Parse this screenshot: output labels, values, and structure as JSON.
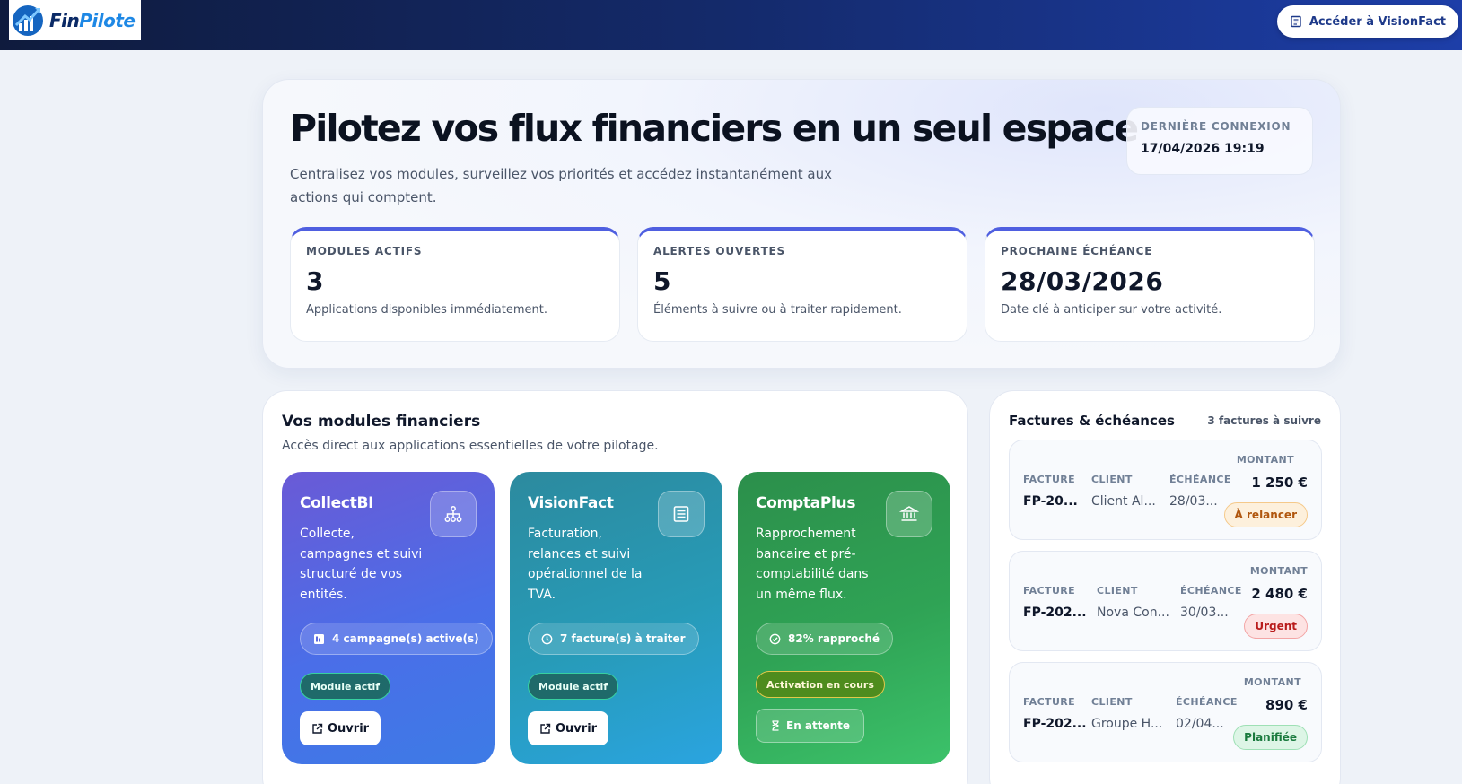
{
  "header": {
    "logo_fin": "Fin",
    "logo_pilote": "Pilote",
    "action_label": "Accéder à VisionFact"
  },
  "hero": {
    "title": "Pilotez vos flux financiers en un seul espace",
    "subtitle": "Centralisez vos modules, surveillez vos priorités et accédez instantanément aux actions qui comptent.",
    "last_login": {
      "label": "DERNIÈRE CONNEXION",
      "value": "17/04/2026 19:19"
    },
    "stats": [
      {
        "label": "MODULES ACTIFS",
        "value": "3",
        "description": "Applications disponibles immédiatement."
      },
      {
        "label": "ALERTES OUVERTES",
        "value": "5",
        "description": "Éléments à suivre ou à traiter rapidement."
      },
      {
        "label": "PROCHAINE ÉCHÉANCE",
        "value": "28/03/2026",
        "description": "Date clé à anticiper sur votre activité."
      }
    ]
  },
  "modules": {
    "title": "Vos modules financiers",
    "subtitle": "Accès direct aux applications essentielles de votre pilotage.",
    "items": [
      {
        "name": "CollectBI",
        "description": "Collecte, campagnes et suivi structuré de vos entités.",
        "stat": "4 campagne(s) active(s)",
        "status": "Module actif",
        "action": "Ouvrir",
        "icon": "sitemap-icon"
      },
      {
        "name": "VisionFact",
        "description": "Facturation, relances et suivi opérationnel de la TVA.",
        "stat": "7 facture(s) à traiter",
        "status": "Module actif",
        "action": "Ouvrir",
        "icon": "invoice-icon"
      },
      {
        "name": "ComptaPlus",
        "description": "Rapprochement bancaire et pré-comptabilité dans un même flux.",
        "stat": "82% rapproché",
        "status": "Activation en cours",
        "action": "En attente",
        "icon": "bank-icon"
      }
    ]
  },
  "invoices": {
    "title": "Factures & échéances",
    "count": "3 factures à suivre",
    "columns": {
      "ref": "FACTURE",
      "client": "CLIENT",
      "due": "ÉCHÉANCE",
      "amount": "MONTANT"
    },
    "rows": [
      {
        "ref": "FP-20...",
        "client": "Client Al...",
        "due": "28/03...",
        "amount": "1 250 €",
        "status": "À relancer"
      },
      {
        "ref": "FP-202...",
        "client": "Nova Con...",
        "due": "30/03...",
        "amount": "2 480 €",
        "status": "Urgent"
      },
      {
        "ref": "FP-202...",
        "client": "Groupe H...",
        "due": "02/04...",
        "amount": "890 €",
        "status": "Planifiée"
      }
    ]
  }
}
